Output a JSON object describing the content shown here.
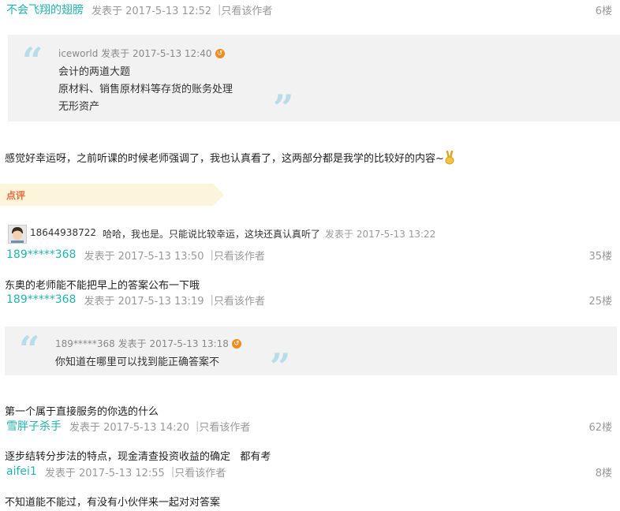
{
  "posts": [
    {
      "user": "不会飞翔的翅膀",
      "meta": "发表于 2017-5-13 12:52",
      "only_author": "只看该作者",
      "floor": "6楼"
    },
    {
      "user": "189*****368",
      "meta": "发表于 2017-5-13 13:50",
      "only_author": "只看该作者",
      "floor": "35楼"
    },
    {
      "user": "189*****368",
      "meta": "发表于 2017-5-13 13:19",
      "only_author": "只看该作者",
      "floor": "25楼"
    },
    {
      "user": "雪胖子杀手",
      "meta": "发表于 2017-5-13 14:20",
      "only_author": "只看该作者",
      "floor": "62楼"
    },
    {
      "user": "aifei1",
      "meta": "发表于 2017-5-13 12:55",
      "only_author": "只看该作者",
      "floor": "8楼"
    }
  ],
  "separator": "|",
  "quote1": {
    "user_meta": "iceworld 发表于 2017-5-13 12:40",
    "lines": [
      "会计的两道大题",
      "原材料、销售原材料等存货的账务处理",
      "无形资产"
    ]
  },
  "post1_text": "感觉好幸运呀，之前听课的时候老师强调了，我也认真看了，这两部分都是我学的比较好的内容~",
  "review": {
    "label": "点评",
    "comment_user": "18644938722",
    "comment_text": "哈哈，我也是。只能说比较幸运，这块还真认真听了",
    "comment_time": "发表于 2017-5-13 13:22"
  },
  "post35_text": "东奥的老师能不能把早上的答案公布一下哦",
  "quote2": {
    "user_meta": "189*****368 发表于 2017-5-13 13:18",
    "lines": [
      "你知道在哪里可以找到能正确答案不"
    ]
  },
  "post25_text": "第一个属于直接服务的你选的什么",
  "post62_text": "逐步结转分步法的特点，现金清查投资收益的确定   都有考",
  "post8_text": "不知道能不能过，有没有小伙伴来一起对对答案",
  "colors": {
    "username": "#22b3ad",
    "accent": "#e86b3a",
    "quote_mark": "#b9dde8"
  }
}
